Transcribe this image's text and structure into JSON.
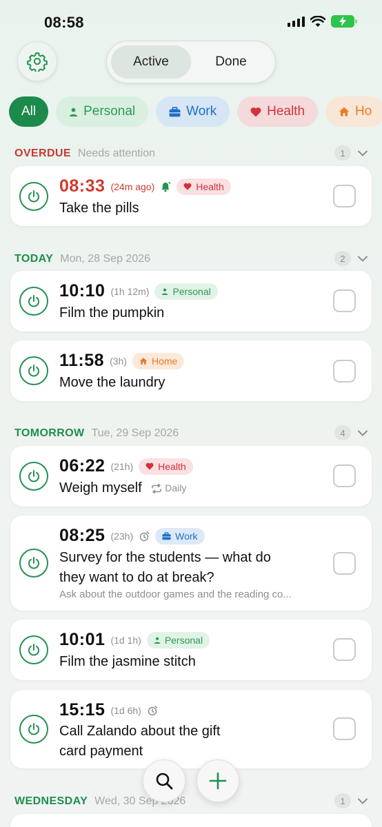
{
  "status_bar": {
    "time": "08:58"
  },
  "header": {
    "segments": [
      {
        "label": "Active",
        "selected": true
      },
      {
        "label": "Done",
        "selected": false
      }
    ]
  },
  "filters": [
    {
      "label": "All",
      "icon": "none",
      "selected": true
    },
    {
      "label": "Personal",
      "icon": "person-icon",
      "color": "#2c9a55"
    },
    {
      "label": "Work",
      "icon": "briefcase-icon",
      "color": "#1f6fc7"
    },
    {
      "label": "Health",
      "icon": "heart-icon",
      "color": "#d2323c"
    },
    {
      "label": "Ho",
      "icon": "home-icon",
      "color": "#ea7a26"
    }
  ],
  "sections": {
    "overdue": {
      "title": "OVERDUE",
      "subtitle": "Needs attention",
      "count": "1",
      "items": [
        {
          "time": "08:33",
          "relative": "(24m ago)",
          "tag": "Health",
          "title": "Take the pills",
          "has_alarm": true
        }
      ]
    },
    "today": {
      "title": "TODAY",
      "subtitle": "Mon, 28 Sep 2026",
      "count": "2",
      "items": [
        {
          "time": "10:10",
          "relative": "(1h 12m)",
          "tag": "Personal",
          "title": "Film the pumpkin"
        },
        {
          "time": "11:58",
          "relative": "(3h)",
          "tag": "Home",
          "title": "Move the laundry"
        }
      ]
    },
    "tomorrow": {
      "title": "TOMORROW",
      "subtitle": "Tue, 29 Sep 2026",
      "count": "4",
      "items": [
        {
          "time": "06:22",
          "relative": "(21h)",
          "tag": "Health",
          "title": "Weigh myself",
          "repeat": "Daily"
        },
        {
          "time": "08:25",
          "relative": "(23h)",
          "tag": "Work",
          "title_line1": "Survey for the students — what do",
          "title_line2": "they want to do at break?",
          "note": "Ask about the outdoor games and the reading co..."
        },
        {
          "time": "10:01",
          "relative": "(1d 1h)",
          "tag": "Personal",
          "title": "Film the jasmine stitch"
        },
        {
          "time": "15:15",
          "relative": "(1d 6h)",
          "title_line1": "Call Zalando about the gift",
          "title_line2": "card payment"
        }
      ]
    },
    "wednesday": {
      "title": "WEDNESDAY",
      "subtitle": "Wed, 30 Sep 2026",
      "count": "1"
    }
  },
  "colors": {
    "accent": "#1b8a4a",
    "overdue": "#cf3a30"
  }
}
